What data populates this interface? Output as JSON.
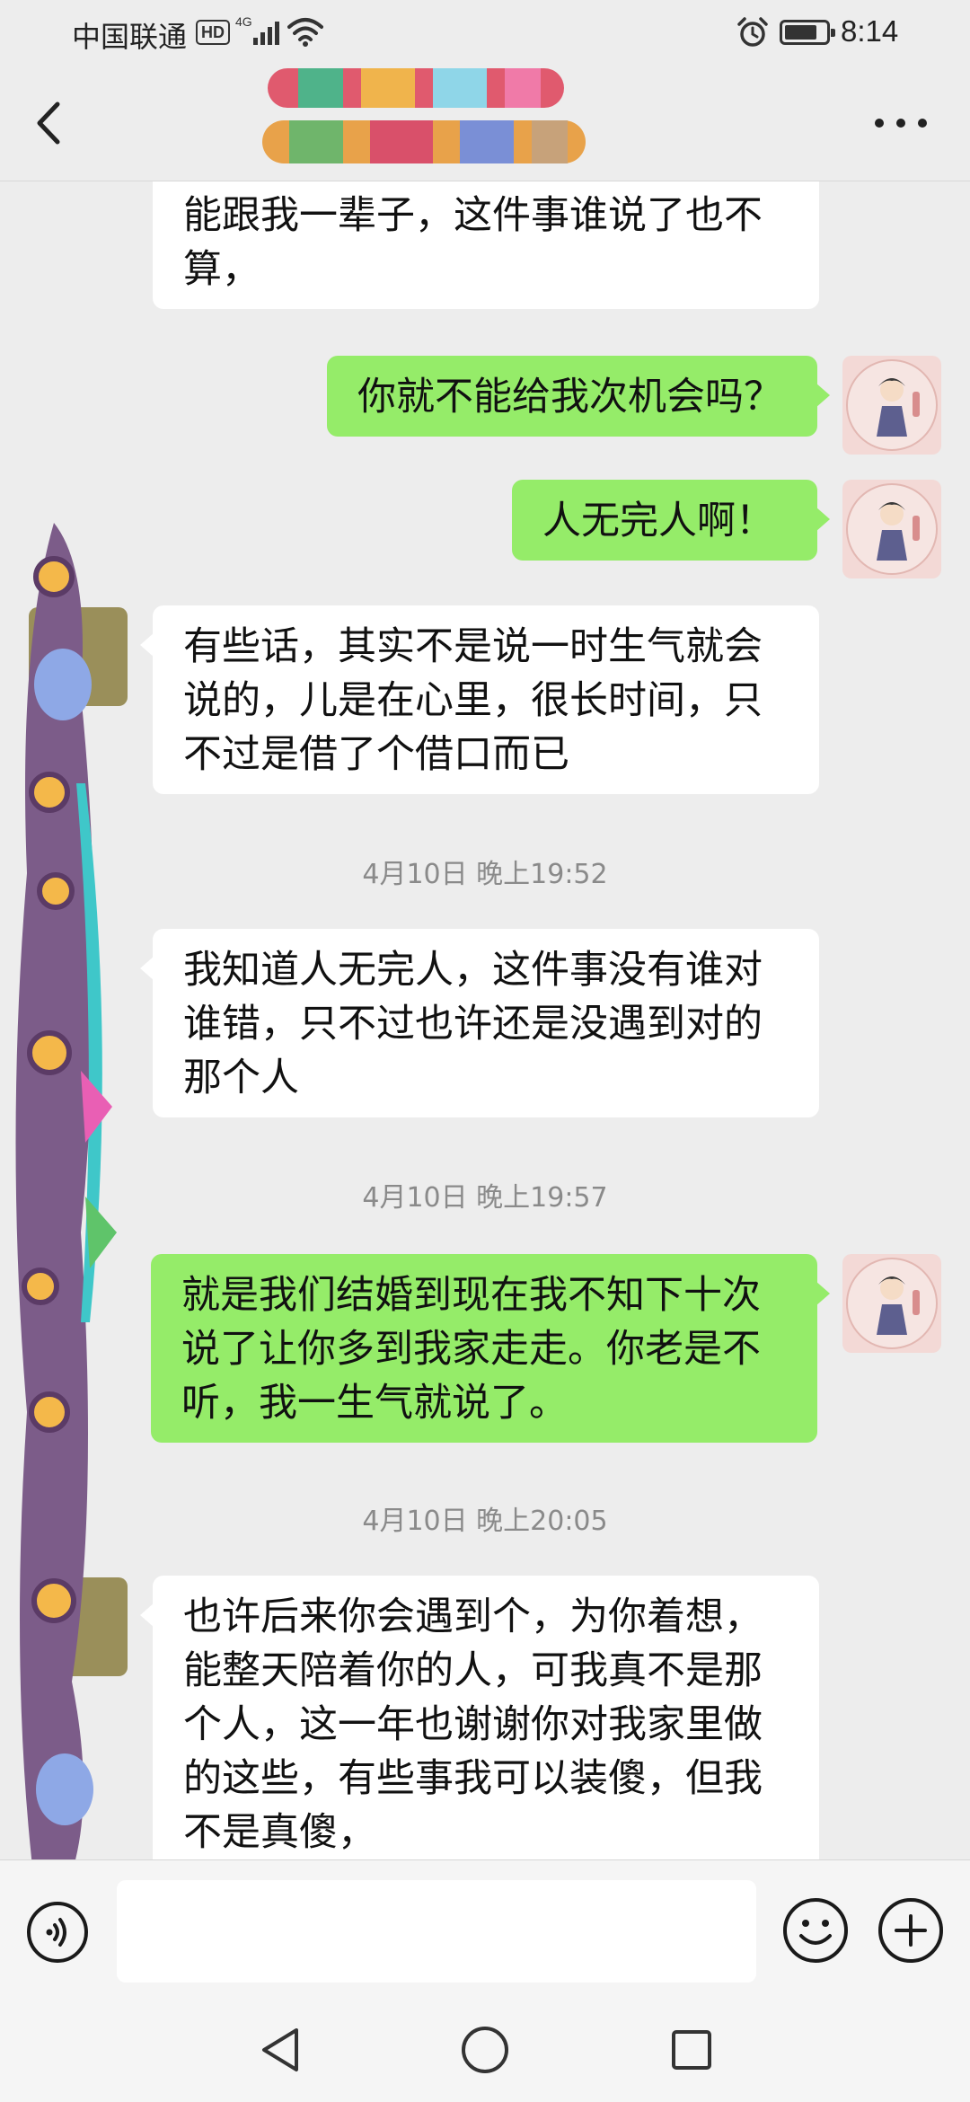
{
  "status_bar": {
    "carrier": "中国联通",
    "hd_badge": "HD",
    "network": "4G",
    "time": "8:14",
    "battery_fraction": 0.8,
    "icons": [
      "hd-badge-icon",
      "signal-icon",
      "wifi-icon",
      "alarm-icon",
      "battery-icon"
    ]
  },
  "header": {
    "title": "",
    "icons": [
      "back-arrow-icon",
      "more-icon"
    ]
  },
  "chat": {
    "messages": [
      {
        "side": "in",
        "text": "也不对，我们都是成年人，他们不能跟我一辈子，这件事谁说了也不算，"
      },
      {
        "side": "out",
        "text": "你就不能给我次机会吗？"
      },
      {
        "side": "out",
        "text": "人无完人啊！"
      },
      {
        "side": "in",
        "text": "有些话，其实不是说一时生气就会说的，儿是在心里，很长时间，只不过是借了个借口而已"
      },
      {
        "side": "in",
        "text": "我知道人无完人，这件事没有谁对谁错，只不过也许还是没遇到对的那个人"
      },
      {
        "side": "out",
        "text": "就是我们结婚到现在我不知下十次说了让你多到我家走走。你老是不听，我一生气就说了。"
      },
      {
        "side": "in",
        "text": "也许后来你会遇到个，为你着想，能整天陪着你的人，可我真不是那个人，这一年也谢谢你对我家里做的这些，有些事我可以装傻，但我不是真傻，"
      }
    ],
    "timestamps": [
      "4月10日 晚上19:52",
      "4月10日 晚上19:57",
      "4月10日 晚上20:05"
    ]
  },
  "input_bar": {
    "value": "",
    "placeholder": "",
    "icons": [
      "voice-icon",
      "emoji-icon",
      "plus-icon"
    ]
  },
  "system_nav": {
    "icons": [
      "nav-back-icon",
      "nav-home-icon",
      "nav-recents-icon"
    ]
  },
  "colors": {
    "background": "#ededed",
    "outgoing_bubble": "#95ec69",
    "incoming_bubble": "#ffffff",
    "timestamp_text": "#8a8a8a"
  }
}
